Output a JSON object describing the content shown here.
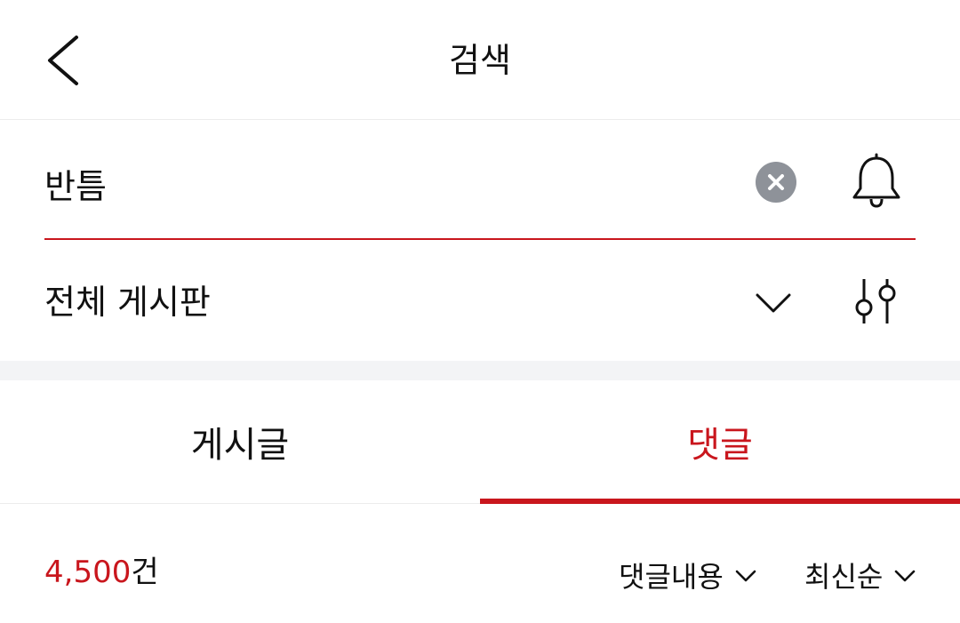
{
  "header": {
    "title": "검색",
    "back_icon": "chevron-left-icon"
  },
  "search": {
    "value": "반틈",
    "clear_icon": "clear-circle-icon",
    "alert_icon": "bell-icon"
  },
  "board": {
    "label": "전체 게시판",
    "dropdown_icon": "chevron-down-icon",
    "filter_icon": "sliders-icon"
  },
  "tabs": [
    {
      "label": "게시글",
      "active": false
    },
    {
      "label": "댓글",
      "active": true
    }
  ],
  "results": {
    "count": "4,500",
    "unit": "건",
    "content_filter": "댓글내용",
    "sort": "최신순"
  },
  "colors": {
    "accent": "#c9161d",
    "text": "#111111",
    "clear_button": "#8e9299",
    "band": "#f3f4f6"
  }
}
